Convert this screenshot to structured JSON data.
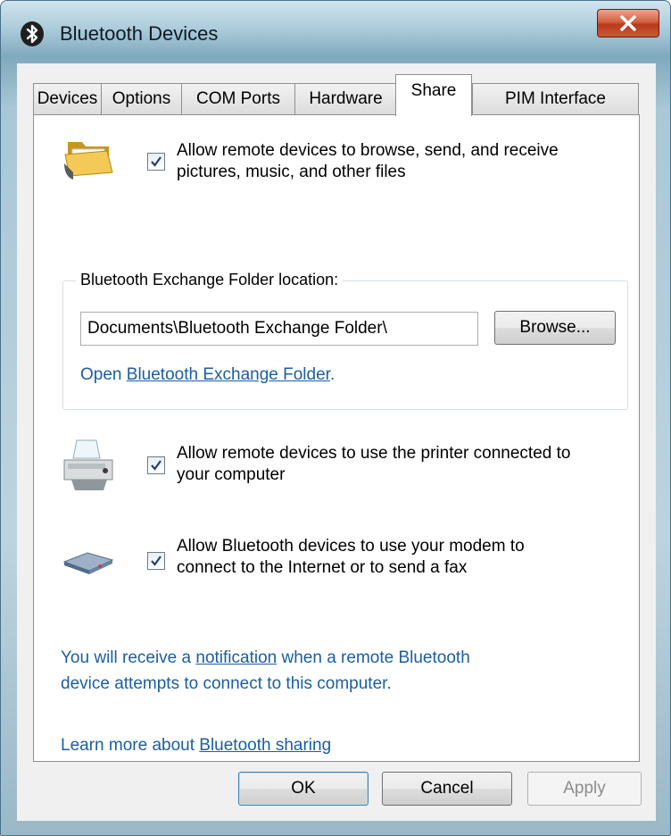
{
  "window": {
    "title": "Bluetooth Devices"
  },
  "tabs": [
    {
      "label": "Devices"
    },
    {
      "label": "Options"
    },
    {
      "label": "COM Ports"
    },
    {
      "label": "Hardware"
    },
    {
      "label": "Share"
    },
    {
      "label": "PIM Interface"
    }
  ],
  "active_tab": "Share",
  "share": {
    "files": {
      "checked": true,
      "line1": "Allow remote devices to browse, send, and receive",
      "line2": "pictures, music, and other files"
    },
    "folder_group": {
      "label": "Bluetooth Exchange Folder location:",
      "path": "Documents\\Bluetooth Exchange Folder\\",
      "browse_label": "Browse...",
      "open_prefix": "Open ",
      "open_link": "Bluetooth Exchange Folder",
      "open_suffix": "."
    },
    "printer": {
      "checked": true,
      "line1": "Allow remote devices to use the printer connected to",
      "line2": "your computer"
    },
    "modem": {
      "checked": true,
      "line1": "Allow Bluetooth devices to use your modem to",
      "line2": "connect to the Internet or to send a fax"
    },
    "notification": {
      "prefix": "You will receive a ",
      "link": "notification",
      "suffix": " when a remote Bluetooth",
      "line2": "device attempts to connect to this computer."
    },
    "learn_more": {
      "prefix": "Learn more about ",
      "link": "Bluetooth sharing"
    }
  },
  "buttons": {
    "ok": "OK",
    "cancel": "Cancel",
    "apply": "Apply"
  },
  "icons": {
    "title": "bluetooth-icon",
    "files": "folder-icon",
    "printer": "printer-icon",
    "modem": "modem-icon"
  },
  "colors": {
    "link": "#1c5ea0",
    "close": "#c8462a"
  }
}
